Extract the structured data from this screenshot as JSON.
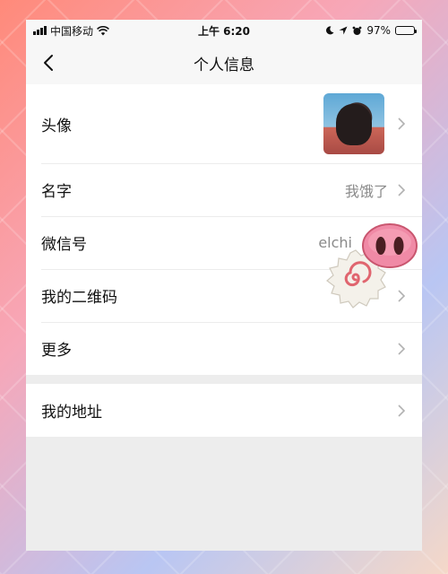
{
  "status_bar": {
    "carrier": "中国移动",
    "time": "上午 6:20",
    "battery": "97%",
    "battery_level": 0.97
  },
  "nav": {
    "title": "个人信息"
  },
  "rows": [
    {
      "label": "头像"
    },
    {
      "label": "名字",
      "value": "我饿了"
    },
    {
      "label": "微信号",
      "value": "elchi"
    },
    {
      "label": "我的二维码"
    },
    {
      "label": "更多"
    }
  ],
  "rows2": [
    {
      "label": "我的地址"
    }
  ]
}
